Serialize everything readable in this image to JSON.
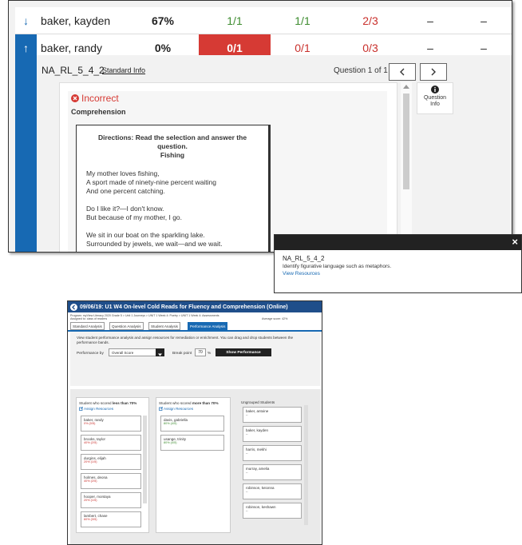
{
  "table": {
    "rows": [
      {
        "arrow": "↓",
        "name": "baker, kayden",
        "score": "67%",
        "cells": [
          "1/1",
          "1/1",
          "2/3",
          "–",
          "–"
        ]
      },
      {
        "arrow": "↑",
        "name": "baker, randy",
        "score": "0%",
        "cells": [
          "0/1",
          "0/1",
          "0/3",
          "–",
          "–"
        ]
      }
    ]
  },
  "question_panel": {
    "standard_code": "NA_RL_5_4_2",
    "standard_info_link": "Standard Info",
    "question_counter": "Question 1 of 1",
    "prev_icon": "chevron-left-icon",
    "next_icon": "chevron-right-icon",
    "result": "Incorrect",
    "category": "Comprehension",
    "question_info_label": "Question Info",
    "passage": {
      "directions": "Directions: Read the selection and answer the question.",
      "title": "Fishing",
      "lines": [
        "My mother loves fishing,",
        "A sport made of ninety-nine percent waiting",
        "And one percent catching.",
        "",
        "Do I like it?—I don't know.",
        "But because of my mother, I go.",
        "",
        "We sit in our boat on the sparkling lake.",
        "Surrounded by jewels, we wait—and we wait."
      ]
    }
  },
  "standard_popup": {
    "code": "NA_RL_5_4_2",
    "description": "Identify figurative language such as metaphors.",
    "link": "View Resources",
    "close": "×"
  },
  "assessment": {
    "title": "09/06/19: U1 W4 On-level Cold Reads for Fluency and Comprehension (Online)",
    "program": "Program: myView Literacy 2020 Grade 5 > Unit 1 Journeys > UNIT 1 Week 4: Poetry > UNIT 1 Week 4: Assessments",
    "assigned": "Assigned to: class of readers",
    "average": "Average score: 42%",
    "tabs": [
      "Standard Analysis",
      "Question Analysis",
      "Student Analysis",
      "Performance Analysis"
    ],
    "active_tab": 3,
    "intro": "View student performance analysis and assign resources for remediation or enrichment. You can drag and drop students between the performance bands.",
    "performance_by_label": "Performance by",
    "performance_by_value": "Overall Score",
    "breakpoint_label": "Break point",
    "breakpoint_value": "70",
    "breakpoint_unit": "%",
    "show_button": "Show Performance",
    "columns": [
      {
        "heading_pre": "Student who scored ",
        "heading_bold": "less than 70%",
        "assign": "Assign Resources",
        "students": [
          {
            "name": "baker, randy",
            "score": "0% (0/5)"
          },
          {
            "name": "brooks, taylor",
            "score": "40% (2/5)"
          },
          {
            "name": "durgins, elijah",
            "score": "20% (1/5)"
          },
          {
            "name": "holmes, deona",
            "score": "40% (2/5)"
          },
          {
            "name": "hooper, montaya",
            "score": "20% (1/5)"
          },
          {
            "name": "lambert, chase",
            "score": "60% (3/5)"
          }
        ]
      },
      {
        "heading_pre": "Student who scored ",
        "heading_bold": "more than 70%",
        "assign": "Assign Resources",
        "students": [
          {
            "name": "davis, gabriella",
            "score": "80% (4/5)"
          },
          {
            "name": "usange, trinity",
            "score": "80% (4/5)"
          }
        ]
      },
      {
        "heading_pre": "Ungrouped Students",
        "heading_bold": "",
        "assign": "",
        "students": [
          {
            "name": "baker, antoine",
            "score": "--"
          },
          {
            "name": "baker, kayden",
            "score": "--"
          },
          {
            "name": "harris, mekhi",
            "score": "--"
          },
          {
            "name": "murray, amelia",
            "score": "--"
          },
          {
            "name": "robinson, keionna",
            "score": "--"
          },
          {
            "name": "robinson, keshawn",
            "score": "--"
          }
        ]
      }
    ]
  }
}
